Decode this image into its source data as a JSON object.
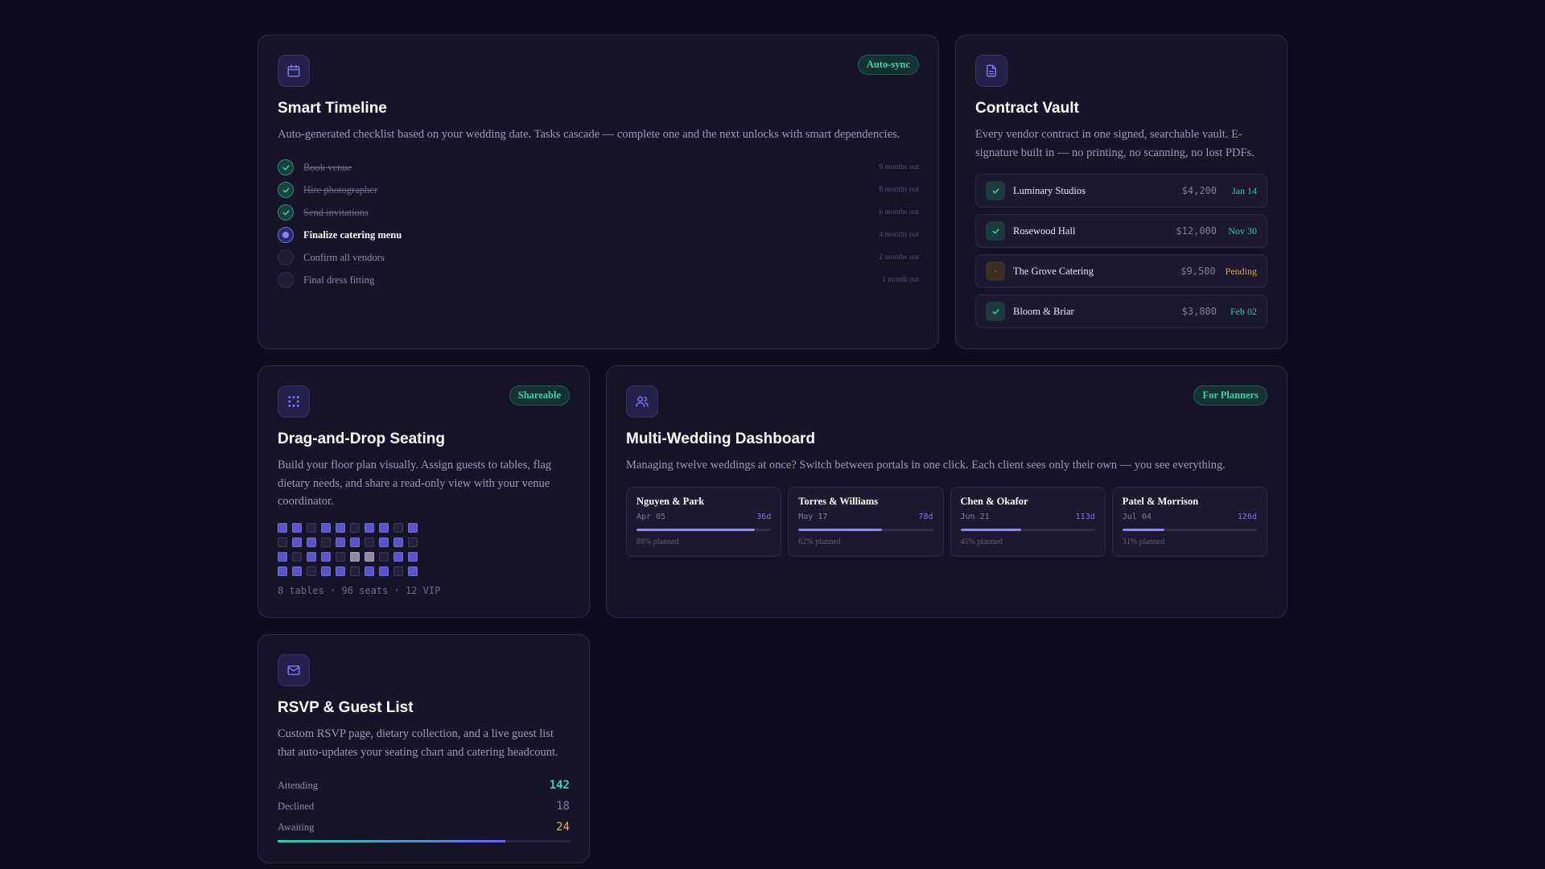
{
  "colors": {
    "background": "#0f0d1c",
    "card": "#171429",
    "accent": "#6b63e8",
    "success": "#3fd1ad",
    "warning": "#d9a44e"
  },
  "timeline": {
    "icon": "calendar-icon",
    "badge": "Auto-sync",
    "title": "Smart Timeline",
    "description": "Auto-generated checklist based on your wedding date. Tasks cascade — complete one and the next unlocks with smart dependencies.",
    "tasks": [
      {
        "label": "Book venue",
        "time": "9 months out",
        "state": "done"
      },
      {
        "label": "Hire photographer",
        "time": "8 months out",
        "state": "done"
      },
      {
        "label": "Send invitations",
        "time": "6 months out",
        "state": "done"
      },
      {
        "label": "Finalize catering menu",
        "time": "4 months out",
        "state": "active"
      },
      {
        "label": "Confirm all vendors",
        "time": "2 months out",
        "state": "todo"
      },
      {
        "label": "Final dress fitting",
        "time": "1 month out",
        "state": "todo"
      }
    ]
  },
  "contracts": {
    "icon": "document-icon",
    "title": "Contract Vault",
    "description": "Every vendor contract in one signed, searchable vault. E-signature built in — no printing, no scanning, no lost PDFs.",
    "items": [
      {
        "vendor": "Luminary Studios",
        "amount": "$4,200",
        "status": "Jan 14",
        "state": "signed"
      },
      {
        "vendor": "Rosewood Hall",
        "amount": "$12,000",
        "status": "Nov 30",
        "state": "signed"
      },
      {
        "vendor": "The Grove Catering",
        "amount": "$9,500",
        "status": "Pending",
        "state": "pending",
        "mark": "·"
      },
      {
        "vendor": "Bloom & Briar",
        "amount": "$3,800",
        "status": "Feb 02",
        "state": "signed"
      }
    ]
  },
  "seating": {
    "icon": "seating-grid-icon",
    "badge": "Shareable",
    "title": "Drag-and-Drop Seating",
    "description": "Build your floor plan visually. Assign guests to tables, flag dietary needs, and share a read-only view with your venue coordinator.",
    "grid": [
      [
        "on",
        "on",
        "off",
        "on",
        "on",
        "off",
        "on",
        "on",
        "off",
        "on"
      ],
      [
        "off",
        "on",
        "on",
        "off",
        "on",
        "on",
        "off",
        "on",
        "on",
        "off"
      ],
      [
        "on",
        "off",
        "on",
        "on",
        "off",
        "vip",
        "vip",
        "off",
        "on",
        "on"
      ],
      [
        "on",
        "on",
        "off",
        "on",
        "on",
        "off",
        "on",
        "on",
        "off",
        "on"
      ]
    ],
    "caption": "8 tables · 96 seats · 12 VIP"
  },
  "dashboard": {
    "icon": "users-icon",
    "badge": "For Planners",
    "title": "Multi-Wedding Dashboard",
    "description": "Managing twelve weddings at once? Switch between portals in one click. Each client sees only their own — you see everything.",
    "weddings": [
      {
        "couple": "Nguyen & Park",
        "date": "Apr 05",
        "days": "36d",
        "planned": "88% planned",
        "progress": 0.88
      },
      {
        "couple": "Torres & Williams",
        "date": "May 17",
        "days": "78d",
        "planned": "62% planned",
        "progress": 0.62
      },
      {
        "couple": "Chen & Okafor",
        "date": "Jun 21",
        "days": "113d",
        "planned": "45% planned",
        "progress": 0.45
      },
      {
        "couple": "Patel & Morrison",
        "date": "Jul 04",
        "days": "126d",
        "planned": "31% planned",
        "progress": 0.31
      }
    ]
  },
  "rsvp": {
    "icon": "mail-icon",
    "title": "RSVP & Guest List",
    "description": "Custom RSVP page, dietary collection, and a live guest list that auto-updates your seating chart and catering headcount.",
    "stats": [
      {
        "label": "Attending",
        "value": "142",
        "kind": "att"
      },
      {
        "label": "Declined",
        "value": "18",
        "kind": "dec"
      },
      {
        "label": "Awaiting",
        "value": "24",
        "kind": "wait"
      }
    ],
    "progress": 0.78
  }
}
